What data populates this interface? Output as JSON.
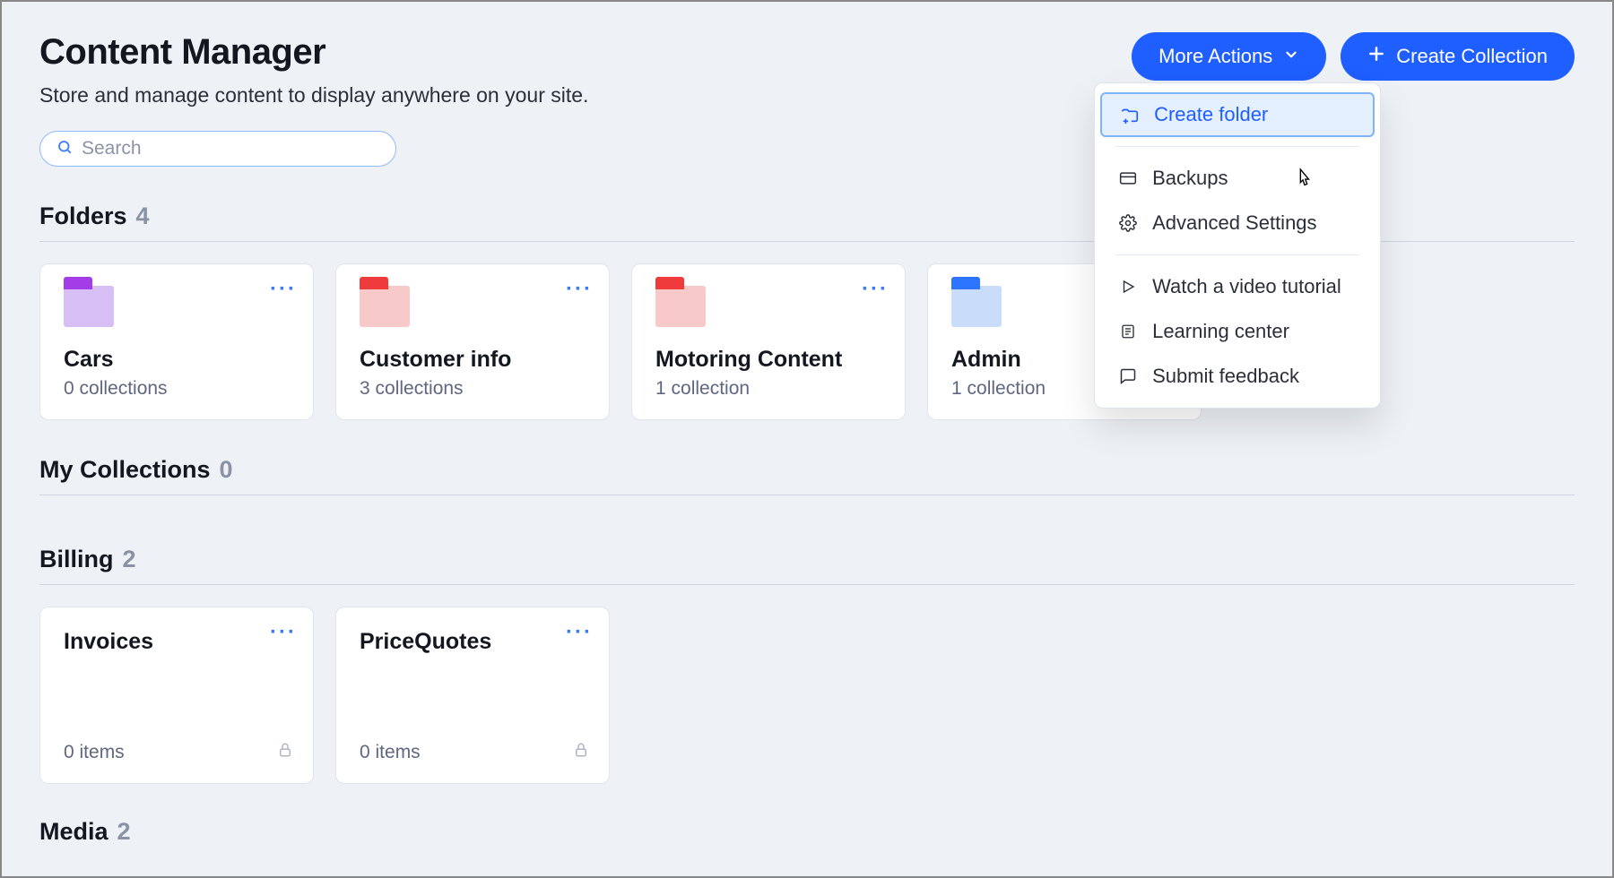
{
  "header": {
    "title": "Content Manager",
    "subtitle": "Store and manage content to display anywhere on your site.",
    "more_actions_label": "More Actions",
    "create_collection_label": "Create Collection"
  },
  "search": {
    "placeholder": "Search"
  },
  "dropdown": {
    "create_folder": "Create folder",
    "backups": "Backups",
    "advanced_settings": "Advanced Settings",
    "watch_tutorial": "Watch a video tutorial",
    "learning_center": "Learning center",
    "submit_feedback": "Submit feedback"
  },
  "sections": {
    "folders": {
      "label": "Folders",
      "count": "4"
    },
    "my_collections": {
      "label": "My Collections",
      "count": "0"
    },
    "billing": {
      "label": "Billing",
      "count": "2"
    },
    "media": {
      "label": "Media",
      "count": "2"
    }
  },
  "folders": [
    {
      "name": "Cars",
      "sub": "0 collections"
    },
    {
      "name": "Customer info",
      "sub": "3 collections"
    },
    {
      "name": "Motoring Content",
      "sub": "1 collection"
    },
    {
      "name": "Admin",
      "sub": "1 collection"
    }
  ],
  "billing": [
    {
      "name": "Invoices",
      "sub": "0 items"
    },
    {
      "name": "PriceQuotes",
      "sub": "0 items"
    }
  ]
}
